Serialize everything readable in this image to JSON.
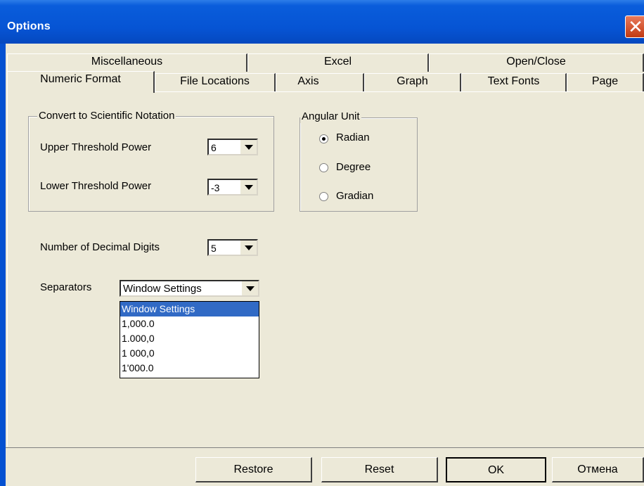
{
  "window": {
    "title": "Options"
  },
  "tabs_row1": [
    "Miscellaneous",
    "Excel",
    "Open/Close"
  ],
  "tabs_row2": [
    "Numeric Format",
    "File Locations",
    "Axis",
    "Graph",
    "Text Fonts",
    "Page"
  ],
  "active_tab": "Numeric Format",
  "scientific": {
    "group_label": "Convert to Scientific Notation",
    "upper_label": "Upper Threshold Power",
    "upper_value": "6",
    "lower_label": "Lower Threshold Power",
    "lower_value": "-3"
  },
  "angular": {
    "group_label": "Angular Unit",
    "options": [
      "Radian",
      "Degree",
      "Gradian"
    ],
    "selected": "Radian"
  },
  "decimal": {
    "label": "Number of Decimal Digits",
    "value": "5"
  },
  "separators": {
    "label": "Separators",
    "value": "Window Settings",
    "options": [
      "Window Settings",
      "1,000.0",
      "1.000,0",
      "1 000,0",
      "1'000.0"
    ]
  },
  "buttons": {
    "restore": "Restore",
    "reset": "Reset",
    "ok": "OK",
    "cancel": "Отмена"
  }
}
